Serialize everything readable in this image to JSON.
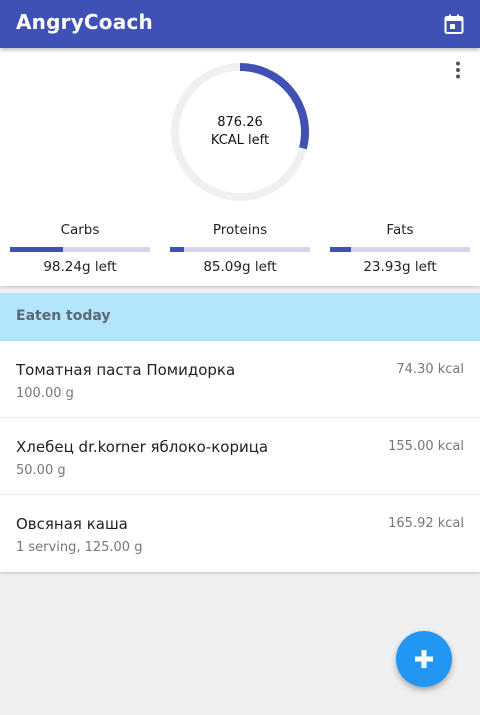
{
  "appbar": {
    "title": "AngryCoach",
    "calendar_icon": "calendar-icon"
  },
  "summary": {
    "kcal_left": "876.26",
    "kcal_label": "KCAL left",
    "kcal_progress": 0.29,
    "more_icon": "more-vert-icon",
    "macros": [
      {
        "name": "Carbs",
        "left": "98.24g left",
        "progress": 0.38
      },
      {
        "name": "Proteins",
        "left": "85.09g left",
        "progress": 0.1
      },
      {
        "name": "Fats",
        "left": "23.93g left",
        "progress": 0.15
      }
    ]
  },
  "eaten": {
    "title": "Eaten today",
    "items": [
      {
        "name": "Томатная паста Помидорка",
        "amount": "100.00 g",
        "kcal": "74.30 kcal"
      },
      {
        "name": "Хлебец dr.korner яблоко-корица",
        "amount": "50.00 g",
        "kcal": "155.00 kcal"
      },
      {
        "name": "Овсяная каша",
        "amount": "1 serving, 125.00 g",
        "kcal": "165.92 kcal"
      }
    ]
  },
  "fab": {
    "icon": "plus-icon"
  },
  "colors": {
    "primary": "#3f51b5",
    "accent": "#2196f3",
    "section_header": "#b3e5fc",
    "track": "#d3d6ee"
  }
}
